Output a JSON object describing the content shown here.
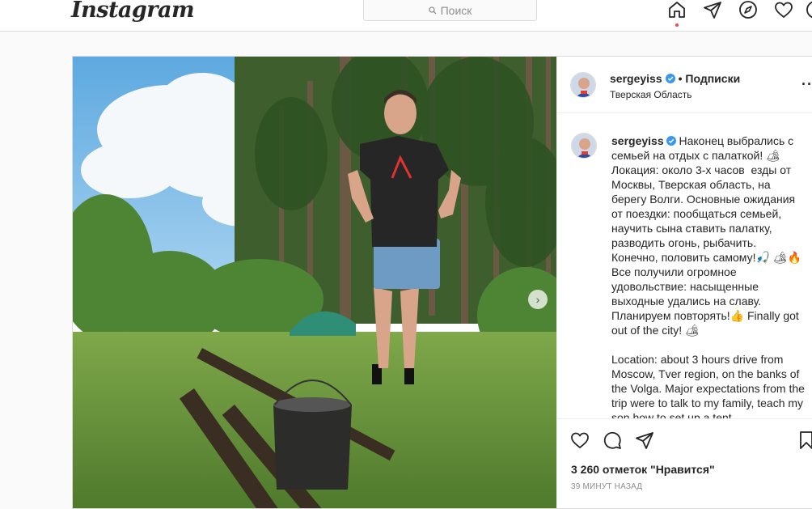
{
  "nav": {
    "logo": "Instagram",
    "search_placeholder": "Поиск",
    "icons": [
      "home-icon",
      "direct-icon",
      "explore-icon",
      "activity-icon",
      "profile-icon"
    ]
  },
  "post": {
    "header": {
      "username": "sergeyiss",
      "follow_label": "• Подписки",
      "location": "Тверская Область"
    },
    "caption": {
      "username": "sergeyiss",
      "text": " Наконец выбрались с семьей на отдых с палаткой! 🏕 Локация: около 3-х часов  езды от Москвы, Тверская область, на берегу Волги. Основные ожидания от поездки: пообщаться семьей, научить сына ставить палатку, разводить огонь, рыбачить. Конечно, половить самому!🎣 🏕🔥 Все получили огромное удовольствие: насыщенные выходные удались на славу. Планируем повторять!👍 Finally got out of the city! 🏕\n\nLocation: about 3 hours drive from Moscow, Tver region, on the banks of the Volga. Major expectations from the trip were to talk to my family, teach my son how to set up a tent"
    },
    "likes": "3 260 отметок \"Нравится\"",
    "timestamp": "39 МИНУТ НАЗАД",
    "colors": {
      "verified": "#3897f0",
      "border": "#dbdbdb",
      "notification": "#ed4956"
    }
  }
}
